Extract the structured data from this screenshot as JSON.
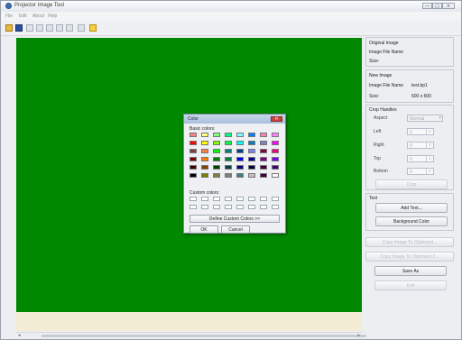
{
  "window": {
    "title": "Projector Image Tool",
    "buttons": [
      "—",
      "▢",
      "✕"
    ]
  },
  "menu": [
    "File",
    "Edit",
    "About",
    "Help"
  ],
  "toolbar": {
    "icons": [
      "open-folder-icon",
      "save-icon",
      "image-icon",
      "image-icon",
      "crop-icon",
      "text-icon",
      "color-icon",
      "image-icon",
      "help-icon"
    ]
  },
  "original_image": {
    "title": "Original Image",
    "file_name_label": "Image File Name",
    "file_name_value": "",
    "size_label": "Size:",
    "size_value": ""
  },
  "new_image": {
    "title": "New Image",
    "file_name_label": "Image File Name",
    "file_name_value": "test.bp1",
    "size_label": "Size:",
    "size_value": "600 x 600"
  },
  "crop": {
    "title": "Crop Handles",
    "aspect_label": "Aspect",
    "aspect_value": "Normal",
    "left_label": "Left",
    "left_value": "0",
    "right_label": "Right",
    "right_value": "0",
    "top_label": "Top",
    "top_value": "0",
    "bottom_label": "Bottom",
    "bottom_value": "0",
    "apply_label": "Crop"
  },
  "text": {
    "title": "Text",
    "add_text": "Add Text...",
    "background_color": "Background Color"
  },
  "actions": {
    "disabled1": "Copy Image To Clipboard...",
    "disabled2": "Copy Image To Clipboard 2...",
    "save_as": "Save As",
    "exit": "Exit"
  },
  "color_dialog": {
    "title": "Color",
    "close": "✕",
    "basic_label": "Basic colors:",
    "custom_label": "Custom colors:",
    "define_button": "Define Custom Colors >>",
    "ok_button": "OK",
    "cancel_button": "Cancel",
    "basic_colors": [
      "#ff8080",
      "#ffff80",
      "#80ff80",
      "#00ff80",
      "#80ffff",
      "#0080ff",
      "#ff80c0",
      "#ff80ff",
      "#ff0000",
      "#ffff00",
      "#80ff00",
      "#00ff40",
      "#00ffff",
      "#0080c0",
      "#8080c0",
      "#ff00ff",
      "#804040",
      "#ff8040",
      "#00ff00",
      "#008080",
      "#004080",
      "#8080ff",
      "#800040",
      "#ff0080",
      "#800000",
      "#ff8000",
      "#008000",
      "#008040",
      "#0000ff",
      "#0000a0",
      "#800080",
      "#8000ff",
      "#400000",
      "#804000",
      "#004000",
      "#004040",
      "#000080",
      "#000040",
      "#400040",
      "#400080",
      "#000000",
      "#808000",
      "#808040",
      "#808080",
      "#408080",
      "#c0c0c0",
      "#400040",
      "#ffffff"
    ]
  },
  "colors": {
    "canvas": "#008800",
    "scroll_area": "#f3edd5"
  }
}
